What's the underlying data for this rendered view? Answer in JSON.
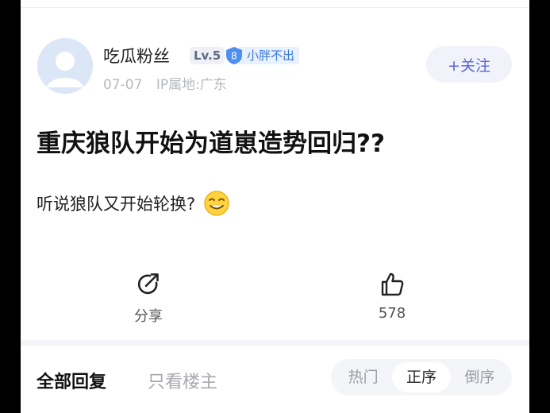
{
  "post": {
    "author": {
      "name": "吃瓜粉丝",
      "level": "Lv.5",
      "fan_badge_level": "8",
      "fan_badge_label": "小胖不出",
      "date": "07-07",
      "ip_location": "IP属地:广东"
    },
    "follow_label": "+关注",
    "title": "重庆狼队开始为道崽造势回归??",
    "body": "听说狼队又开始轮换?",
    "actions": {
      "share_label": "分享",
      "like_count": "578"
    }
  },
  "reply_tabs": {
    "all": "全部回复",
    "owner_only": "只看楼主"
  },
  "sort": {
    "options": [
      "热门",
      "正序",
      "倒序"
    ],
    "selected": "正序"
  },
  "colors": {
    "accent": "#5a66d8",
    "badge_blue": "#3a78d8"
  }
}
